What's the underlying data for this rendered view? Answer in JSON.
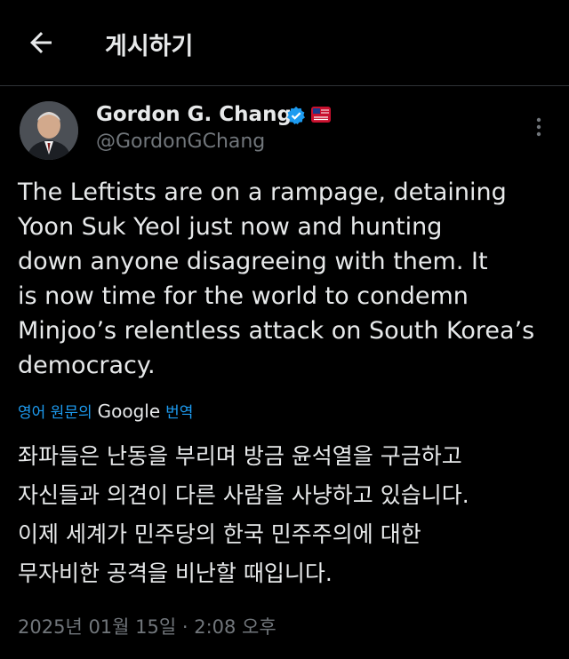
{
  "header": {
    "back_icon": "arrow-left-icon",
    "title": "게시하기"
  },
  "post": {
    "author_name": "Gordon G. Chang",
    "author_handle": "@GordonGChang",
    "verified_icon": "verified-badge-icon",
    "affiliation_icon": "affiliation-badge-icon",
    "more_icon": "more-vertical-icon",
    "text": "The Leftists are on a rampage, detaining\nYoon Suk Yeol just now and hunting\ndown anyone disagreeing with them. It\nis now time for the world to condemn\nMinjoo’s relentless attack on South Korea’s\ndemocracy.",
    "translate_prefix": "영어 원문의",
    "translate_brand": "Google",
    "translate_suffix": "번역",
    "translated_text": "좌파들은 난동을 부리며 방금 윤석열을 구금하고\n자신들과 의견이 다른 사람을 사냥하고 있습니다.\n이제 세계가 민주당의 한국 민주주의에 대한\n무자비한 공격을 비난할 때입니다.",
    "timestamp": "2025년 01월 15일 · 2:08 오후"
  },
  "colors": {
    "background": "#000000",
    "text": "#e7e9ea",
    "muted": "#71767b",
    "link": "#1d9bf0",
    "verified": "#1d9bf0",
    "affiliation": "#c8102e"
  }
}
